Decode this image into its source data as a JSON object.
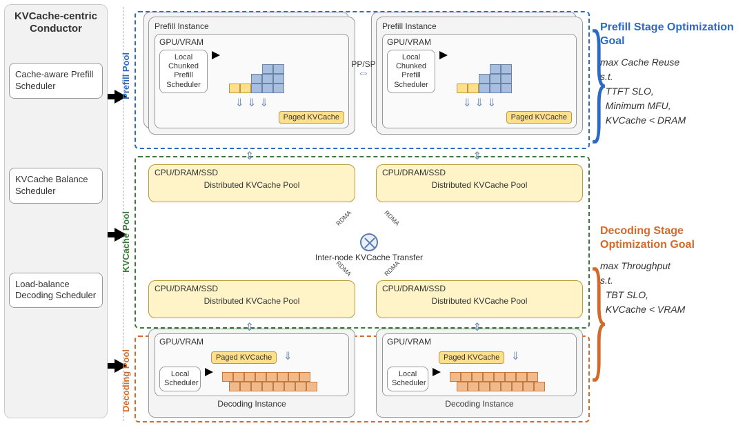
{
  "conductor": {
    "title": "KVCache-centric Conductor",
    "schedulers": [
      "Cache-aware Prefill Scheduler",
      "KVCache Balance Scheduler",
      "Load-balance Decoding Scheduler"
    ]
  },
  "pools": {
    "prefill_label": "Prefill Pool",
    "kvcache_label": "KVCache Pool",
    "decoding_label": "Decoding Pool"
  },
  "prefill_instance": {
    "title": "Prefill Instance",
    "gpu_label": "GPU/VRAM",
    "scheduler": "Local Chunked Prefill Scheduler",
    "paged": "Paged KVCache"
  },
  "decoding_instance": {
    "title": "Decoding Instance",
    "gpu_label": "GPU/VRAM",
    "scheduler": "Local Scheduler",
    "paged": "Paged KVCache"
  },
  "dist_pool": {
    "tier_label": "CPU/DRAM/SSD",
    "name": "Distributed KVCache Pool"
  },
  "links": {
    "ppsp": "PP/SP",
    "internode": "Inter-node KVCache Transfer",
    "rdma": "RDMA"
  },
  "goals": {
    "prefill": {
      "title": "Prefill Stage Optimization Goal",
      "lines": [
        "max Cache Reuse",
        "s.t.",
        "  TTFT SLO,",
        "  Minimum MFU,",
        "  KVCache < DRAM"
      ]
    },
    "decoding": {
      "title": "Decoding Stage Optimization Goal",
      "lines": [
        "max Throughput",
        "s.t.",
        "  TBT SLO,",
        "  KVCache < VRAM"
      ]
    }
  }
}
